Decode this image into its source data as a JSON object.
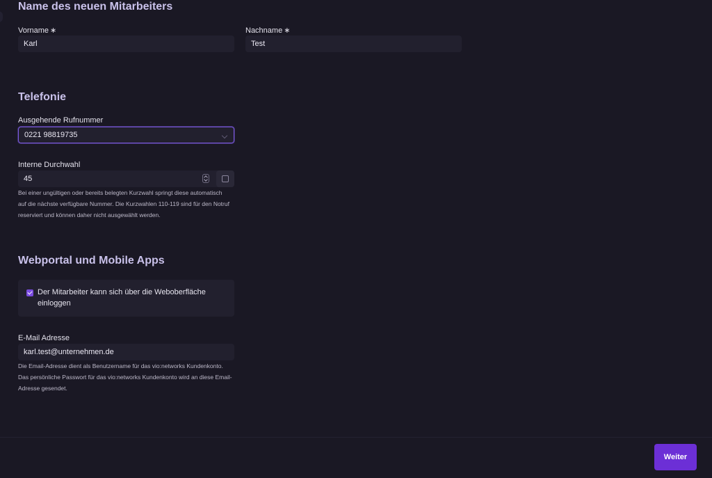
{
  "sections": {
    "name": {
      "title": "Name des neuen Mitarbeiters",
      "first_name_label": "Vorname",
      "first_name_value": "Karl",
      "last_name_label": "Nachname",
      "last_name_value": "Test",
      "required_mark": "∗"
    },
    "telephony": {
      "title": "Telefonie",
      "outgoing_label": "Ausgehende Rufnummer",
      "outgoing_value": "0221 98819735",
      "extension_label": "Interne Durchwahl",
      "extension_value": "45",
      "extension_help": "Bei einer ungültigen oder bereits belegten Kurzwahl springt diese automatisch auf die nächste verfügbare Nummer. Die Kurzwahlen 110-119 sind für den Notruf reserviert und können daher nicht ausgewählt werden."
    },
    "webportal": {
      "title": "Webportal und Mobile Apps",
      "login_checkbox_label": "Der Mitarbeiter kann sich über die Weboberfläche einloggen",
      "login_checked": true,
      "email_label": "E-Mail Adresse",
      "email_value": "karl.test@unternehmen.de",
      "email_help": "Die Email-Adresse dient als Benutzername für das vio:networks Kundenkonto. Das persönliche Passwort für das vio:networks Kundenkonto wird an diese Email-Adresse gesendet."
    }
  },
  "footer": {
    "next_label": "Weiter"
  },
  "colors": {
    "background": "#1a1824",
    "accent": "#6c2fd6",
    "heading": "#c9c1ea",
    "field_bg": "#22202e"
  }
}
